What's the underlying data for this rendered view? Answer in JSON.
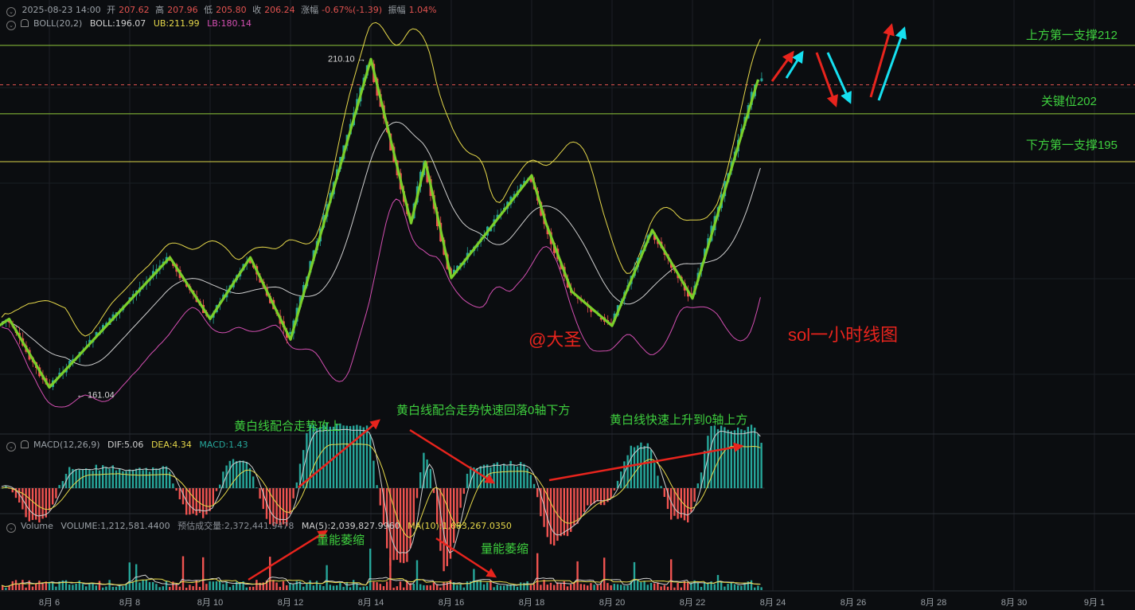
{
  "header": {
    "datetime": "2025-08-23 14:00",
    "open_label": "开",
    "open": "207.62",
    "high_label": "高",
    "high": "207.96",
    "low_label": "低",
    "low": "205.80",
    "close_label": "收",
    "close": "206.24",
    "change_label": "涨幅",
    "change": "-0.67%(-1.39)",
    "amplitude_label": "振幅",
    "amplitude": "1.04%"
  },
  "boll": {
    "name": "BOLL(20,2)",
    "mid_label": "BOLL:196.07",
    "ub_label": "UB:211.99",
    "lb_label": "LB:180.14"
  },
  "macd": {
    "name": "MACD(12,26,9)",
    "dif_label": "DIF:5.06",
    "dea_label": "DEA:4.34",
    "macd_label": "MACD:1.43"
  },
  "volume": {
    "name": "Volume",
    "volume_label": "VOLUME:1,212,581.4400",
    "est_label": "预估成交量:2,372,441.9478",
    "ma5_label": "MA(5):2,039,827.9960",
    "ma10_label": "MA(10):1,683,267.0350"
  },
  "colors": {
    "up": "#26a69a",
    "down": "#ef5350",
    "boll_ub": "#e6d84a",
    "boll_mid": "#cfcfcf",
    "boll_lb": "#d44fb2",
    "zigzag": "#7bcf2a",
    "annot_green": "#3ecf3e",
    "annot_red": "#e8241d",
    "cyan": "#16e0f0",
    "level_line": "#8fc83a",
    "support_line": "#d9d34a"
  },
  "chart_data": {
    "type": "candlestick",
    "title": "sol一小时线图",
    "watermark": "@大圣",
    "x_ticks": [
      "8月 6",
      "8月 8",
      "8月 10",
      "8月 12",
      "8月 14",
      "8月 16",
      "8月 18",
      "8月 20",
      "8月 22",
      "8月 24",
      "8月 26",
      "8月 28",
      "8月 30",
      "9月 1"
    ],
    "price_ylim": [
      155,
      215
    ],
    "labeled_points": [
      {
        "label": "210.10",
        "date": "8月 14",
        "price": 210.1
      },
      {
        "label": "161.04",
        "date": "8月 6",
        "price": 161.04
      }
    ],
    "levels": [
      {
        "label": "上方第一支撑212",
        "price": 212
      },
      {
        "label": "关键位202",
        "price": 202
      },
      {
        "label": "下方第一支撑195",
        "price": 195
      }
    ],
    "zigzag": [
      {
        "date": "8月 4",
        "price": 168
      },
      {
        "date": "8月 5",
        "price": 172
      },
      {
        "date": "8月 6",
        "price": 162
      },
      {
        "date": "8月 9",
        "price": 181
      },
      {
        "date": "8月 10",
        "price": 172
      },
      {
        "date": "8月 11",
        "price": 181
      },
      {
        "date": "8月 12",
        "price": 169
      },
      {
        "date": "8月 14",
        "price": 210
      },
      {
        "date": "8月 15",
        "price": 186
      },
      {
        "date": "8月 15",
        "price": 195
      },
      {
        "date": "8月 16",
        "price": 178
      },
      {
        "date": "8月 18",
        "price": 193
      },
      {
        "date": "8月 18",
        "price": 186
      },
      {
        "date": "8月 19",
        "price": 176
      },
      {
        "date": "8月 20",
        "price": 171
      },
      {
        "date": "8月 21",
        "price": 185
      },
      {
        "date": "8月 22",
        "price": 175
      },
      {
        "date": "8月 23",
        "price": 207
      }
    ],
    "macd_annotations": [
      "黄白线配合走势攻上",
      "黄白线配合走势快速回落0轴下方",
      "黄白线快速上升到0轴上方"
    ],
    "volume_annotations": [
      "量能萎缩",
      "量能萎缩"
    ]
  }
}
